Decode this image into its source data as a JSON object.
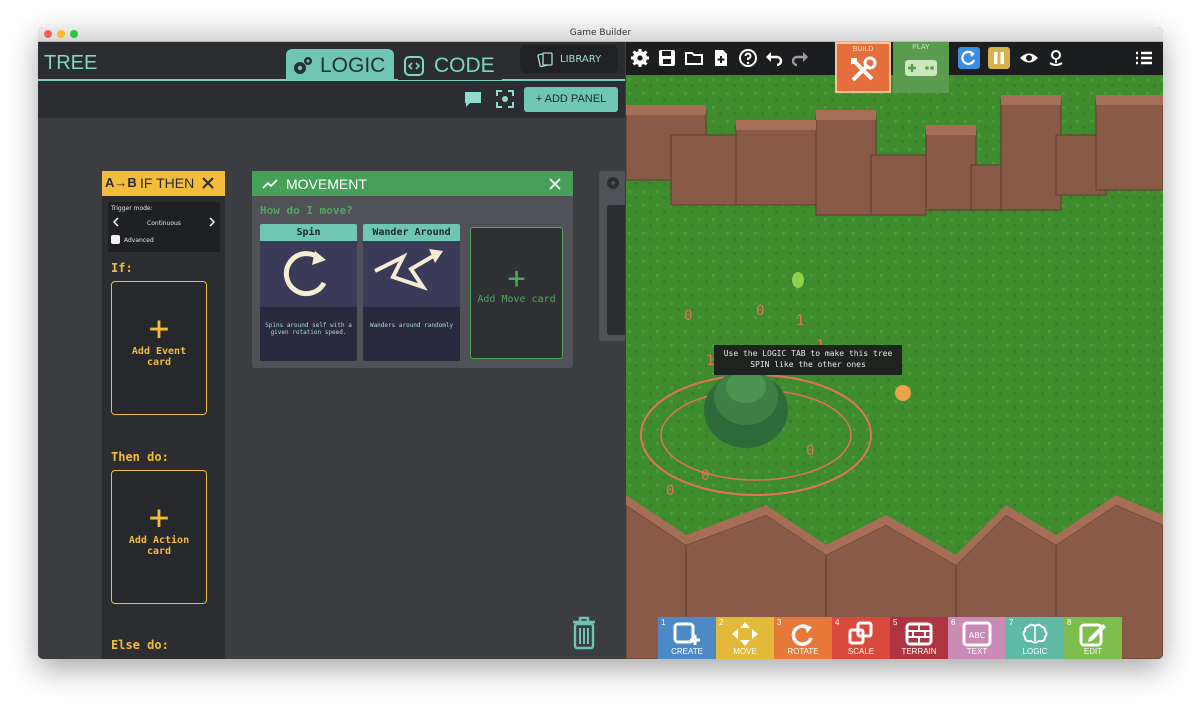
{
  "window": {
    "title": "Game Builder"
  },
  "left": {
    "title": "TREE",
    "tabs": {
      "logic": "LOGIC",
      "code": "CODE"
    },
    "library_label": "LIBRARY",
    "add_panel_label": "+ ADD PANEL"
  },
  "ifthen": {
    "title": "IF THEN",
    "badge": "A→B",
    "trigger_label": "Trigger mode:",
    "trigger_value": "Continuous",
    "advanced_label": "Advanced",
    "if_label": "If:",
    "add_event_label": "Add Event card",
    "then_label": "Then do:",
    "add_action_label": "Add Action card",
    "else_label": "Else do:"
  },
  "movement": {
    "title": "MOVEMENT",
    "question": "How do I move?",
    "cards": [
      {
        "title": "Spin",
        "desc": "Spins around self with a given rotation speed."
      },
      {
        "title": "Wander Around",
        "desc": "Wanders around randomly"
      }
    ],
    "add_move_label": "Add Move card"
  },
  "game": {
    "build_label": "BUILD",
    "play_label": "PLAY",
    "tooltip": "Use the LOGIC TAB to make this tree SPIN like the other ones",
    "tools": [
      {
        "num": "1",
        "name": "CREATE",
        "color": "#4e89c7"
      },
      {
        "num": "2",
        "name": "MOVE",
        "color": "#e3b93a"
      },
      {
        "num": "3",
        "name": "ROTATE",
        "color": "#e6783a"
      },
      {
        "num": "4",
        "name": "SCALE",
        "color": "#d94a3c"
      },
      {
        "num": "5",
        "name": "TERRAIN",
        "color": "#b0343f"
      },
      {
        "num": "6",
        "name": "TEXT",
        "color": "#c98ab5"
      },
      {
        "num": "7",
        "name": "LOGIC",
        "color": "#5fb9a5"
      },
      {
        "num": "8",
        "name": "EDIT",
        "color": "#7dbd4e"
      }
    ]
  }
}
